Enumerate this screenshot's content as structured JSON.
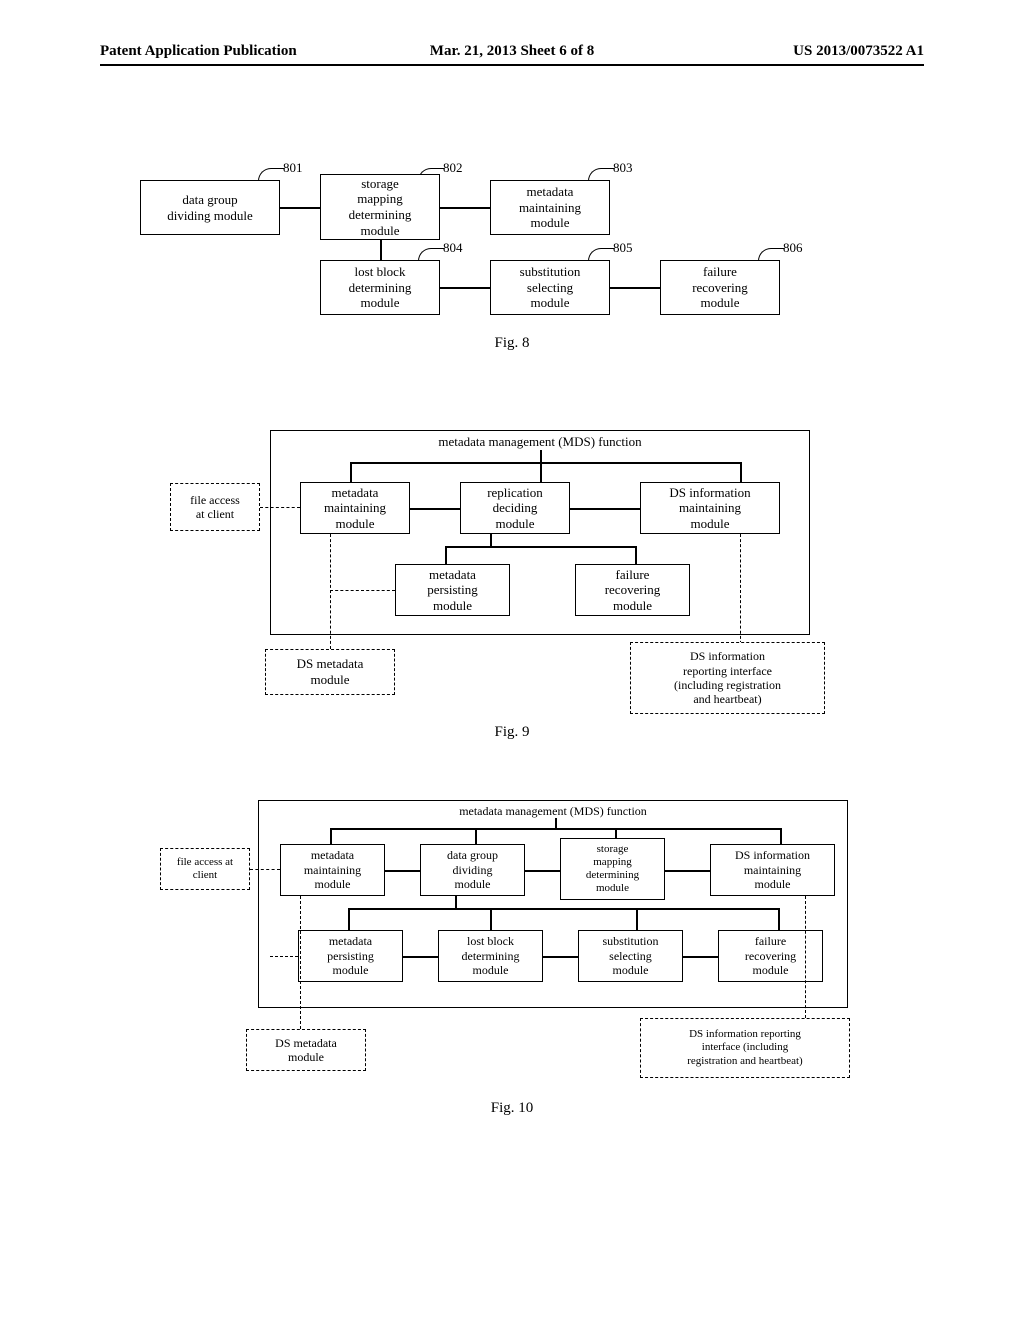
{
  "header": {
    "left": "Patent Application Publication",
    "mid": "Mar. 21, 2013  Sheet 6 of 8",
    "right": "US 2013/0073522 A1"
  },
  "fig8": {
    "caption": "Fig. 8",
    "tags": {
      "b801": "801",
      "b802": "802",
      "b803": "803",
      "b804": "804",
      "b805": "805",
      "b806": "806"
    },
    "b801": "data group\ndividing module",
    "b802": "storage\nmapping\ndetermining\nmodule",
    "b803": "metadata\nmaintaining\nmodule",
    "b804": "lost block\ndetermining\nmodule",
    "b805": "substitution\nselecting\nmodule",
    "b806": "failure\nrecovering\nmodule"
  },
  "fig9": {
    "caption": "Fig. 9",
    "title": "metadata management (MDS) function",
    "client": "file access\nat client",
    "m_maintain": "metadata\nmaintaining\nmodule",
    "m_replication": "replication\ndeciding\nmodule",
    "m_dsinfo": "DS information\nmaintaining\nmodule",
    "m_persist": "metadata\npersisting\nmodule",
    "m_fail": "failure\nrecovering\nmodule",
    "ds_meta": "DS metadata\nmodule",
    "ds_report": "DS information\nreporting interface\n(including registration\nand heartbeat)"
  },
  "fig10": {
    "caption": "Fig. 10",
    "title": "metadata management (MDS) function",
    "client": "file access at\nclient",
    "m_maintain": "metadata\nmaintaining\nmodule",
    "m_divide": "data group\ndividing\nmodule",
    "m_storage": "storage\nmapping\ndetermining\nmodule",
    "m_dsinfo": "DS information\nmaintaining\nmodule",
    "m_persist": "metadata\npersisting\nmodule",
    "m_lost": "lost block\ndetermining\nmodule",
    "m_subst": "substitution\nselecting\nmodule",
    "m_fail": "failure\nrecovering\nmodule",
    "ds_meta": "DS metadata\nmodule",
    "ds_report": "DS information reporting\ninterface (including\nregistration and heartbeat)"
  }
}
